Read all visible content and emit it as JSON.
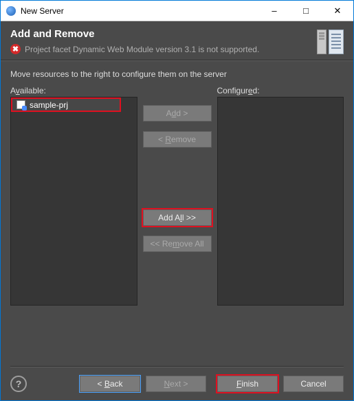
{
  "window": {
    "title": "New Server"
  },
  "header": {
    "title": "Add and Remove",
    "error": "Project facet Dynamic Web Module version 3.1 is not supported."
  },
  "body": {
    "instruction": "Move resources to the right to configure them on the server",
    "available_label_pre": "A",
    "available_label_u": "v",
    "available_label_post": "ailable:",
    "configured_label_pre": "Configur",
    "configured_label_u": "e",
    "configured_label_post": "d:",
    "available_items": [
      {
        "name": "sample-prj"
      }
    ]
  },
  "buttons": {
    "add_pre": "A",
    "add_u": "d",
    "add_post": "d >",
    "remove_pre": "< ",
    "remove_u": "R",
    "remove_post": "emove",
    "addall_pre": "Add A",
    "addall_u": "l",
    "addall_post": "l >>",
    "removeall_pre": "<< Re",
    "removeall_u": "m",
    "removeall_post": "ove All"
  },
  "footer": {
    "back_pre": "< ",
    "back_u": "B",
    "back_post": "ack",
    "next_pre": "",
    "next_u": "N",
    "next_post": "ext >",
    "finish_pre": "",
    "finish_u": "F",
    "finish_post": "inish",
    "cancel": "Cancel"
  }
}
